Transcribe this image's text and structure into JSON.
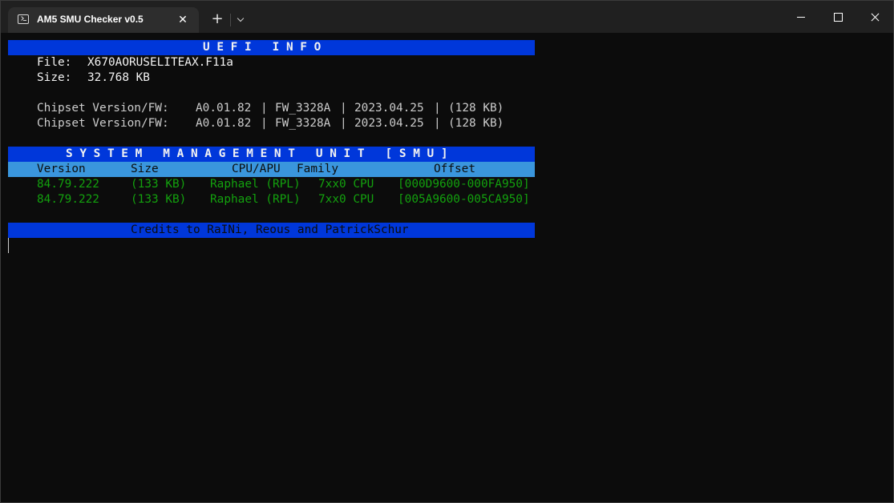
{
  "window": {
    "tab_title": "AM5 SMU Checker v0.5",
    "tab_close": "✕",
    "new_tab": "+"
  },
  "uefi": {
    "header": "U E F I   I N F O",
    "file_label": "File:",
    "file_value": "X670AORUSELITEAX.F11a",
    "size_label": "Size:",
    "size_value": "32.768 KB",
    "chipset_rows": [
      {
        "label": "Chipset Version/FW:",
        "version": "A0.01.82",
        "fw": "FW_3328A",
        "date": "2023.04.25",
        "size": "(128 KB)"
      },
      {
        "label": "Chipset Version/FW:",
        "version": "A0.01.82",
        "fw": "FW_3328A",
        "date": "2023.04.25",
        "size": "(128 KB)"
      }
    ],
    "separator": "|"
  },
  "smu": {
    "header": "S Y S T E M   M A N A G E M E N T   U N I T   [ S M U ]",
    "columns": {
      "version": "Version",
      "size": "Size",
      "cpu": "CPU/APU",
      "family": "Family",
      "offset": "Offset"
    },
    "rows": [
      {
        "version": "84.79.222",
        "size": "(133 KB)",
        "cpu": "Raphael (RPL)",
        "family": "7xx0 CPU",
        "offset": "[000D9600-000FA950]"
      },
      {
        "version": "84.79.222",
        "size": "(133 KB)",
        "cpu": "Raphael (RPL)",
        "family": "7xx0 CPU",
        "offset": "[005A9600-005CA950]"
      }
    ]
  },
  "credits": "Credits to RaINi, Reous and PatrickSchur",
  "colors": {
    "background": "#0c0c0c",
    "header_bar": "#0037da",
    "column_bar": "#3a96dd",
    "green_text": "#13a10e",
    "default_text": "#cccccc"
  }
}
